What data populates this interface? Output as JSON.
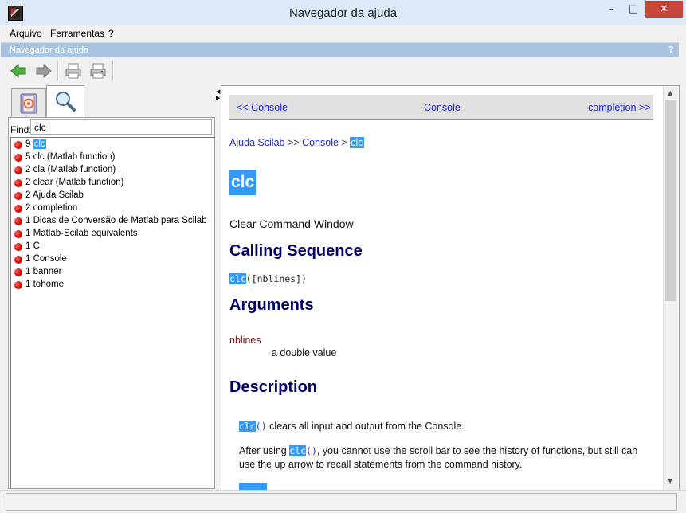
{
  "window": {
    "title": "Navegador da ajuda",
    "controls": {
      "minimize": "–",
      "maximize": "□",
      "close": "✕"
    }
  },
  "menu": [
    "Arquivo",
    "Ferramentas",
    "?"
  ],
  "help_header": {
    "label": "Navegador da ajuda",
    "help_mark": "?"
  },
  "toolbar": {
    "icons": [
      "back-arrow-icon",
      "forward-arrow-icon",
      "print-icon",
      "page-setup-icon"
    ],
    "colors": {
      "back": "#3ea83a",
      "forward_disabled": "#8a8a8a"
    }
  },
  "search": {
    "find_label": "Find:",
    "query": "clc",
    "results": [
      {
        "count": "9",
        "text": "clc",
        "selected": true
      },
      {
        "count": "5",
        "text": "clc (Matlab function)",
        "selected": false
      },
      {
        "count": "2",
        "text": "cla (Matlab function)",
        "selected": false
      },
      {
        "count": "2",
        "text": "clear (Matlab function)",
        "selected": false
      },
      {
        "count": "2",
        "text": "Ajuda Scilab",
        "selected": false
      },
      {
        "count": "2",
        "text": "completion",
        "selected": false
      },
      {
        "count": "1",
        "text": "Dicas de Conversão de Matlab para Scilab",
        "selected": false
      },
      {
        "count": "1",
        "text": "Matlab-Scilab equivalents",
        "selected": false
      },
      {
        "count": "1",
        "text": "C",
        "selected": false
      },
      {
        "count": "1",
        "text": "Console",
        "selected": false
      },
      {
        "count": "1",
        "text": "banner",
        "selected": false
      },
      {
        "count": "1",
        "text": "tohome",
        "selected": false
      }
    ]
  },
  "page": {
    "nav": {
      "prev": "<< Console",
      "up": "Console",
      "next": "completion >>"
    },
    "breadcrumb": {
      "root": "Ajuda Scilab",
      "sep1": ">>",
      "section": "Console",
      "sep2": ">",
      "current": "clc"
    },
    "refname": "clc",
    "refpurpose": "Clear Command Window",
    "calling_heading": "Calling Sequence",
    "calling": {
      "fn": "clc",
      "args": "([nblines])"
    },
    "arguments_heading": "Arguments",
    "argument": {
      "name": "nblines",
      "desc": "a double value"
    },
    "description_heading": "Description",
    "desc_p1": {
      "fn": "clc",
      "paren": "()",
      "text": " clears all input and output from the Console."
    },
    "desc_p2": {
      "lead": "After using ",
      "fn": "clc",
      "paren": "()",
      "text": ", you cannot use the scroll bar to see the history of functions, but still can use the up arrow to recall statements from the command history."
    },
    "highlight_color": "#3399ff",
    "heading_color": "#000066",
    "link_color": "#1c29d8"
  }
}
